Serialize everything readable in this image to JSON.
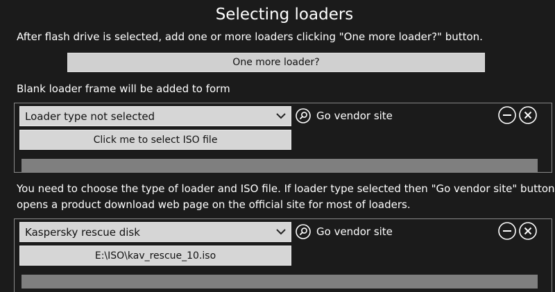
{
  "title": "Selecting loaders",
  "intro_text": "After flash drive is selected, add one or more loaders clicking \"One more loader?\" button.",
  "add_button_label": "One more loader?",
  "blank_note": "Blank loader frame will be added to form",
  "explain_line1": "You need to choose the type of loader and ISO file. If loader type selected then \"Go vendor site\" button",
  "explain_line2": "opens a product download web page on the official site for most of loaders.",
  "frames": [
    {
      "loader_type": "Loader type not selected",
      "iso_button_label": "Click me to select ISO file",
      "vendor_label": "Go vendor site",
      "progress": 0
    },
    {
      "loader_type": "Kaspersky rescue disk",
      "iso_button_label": "E:\\ISO\\kav_rescue_10.iso",
      "vendor_label": "Go vendor site",
      "progress": 0
    }
  ],
  "icons": {
    "dropdown": "chevron-down-icon",
    "vendor": "search-icon",
    "remove": "minus-icon",
    "close": "close-icon"
  },
  "colors": {
    "background": "#1b1b1b",
    "button": "#d6d6d6",
    "frame_border": "#8a8a8a",
    "progress_track": "#7f7f7f"
  }
}
